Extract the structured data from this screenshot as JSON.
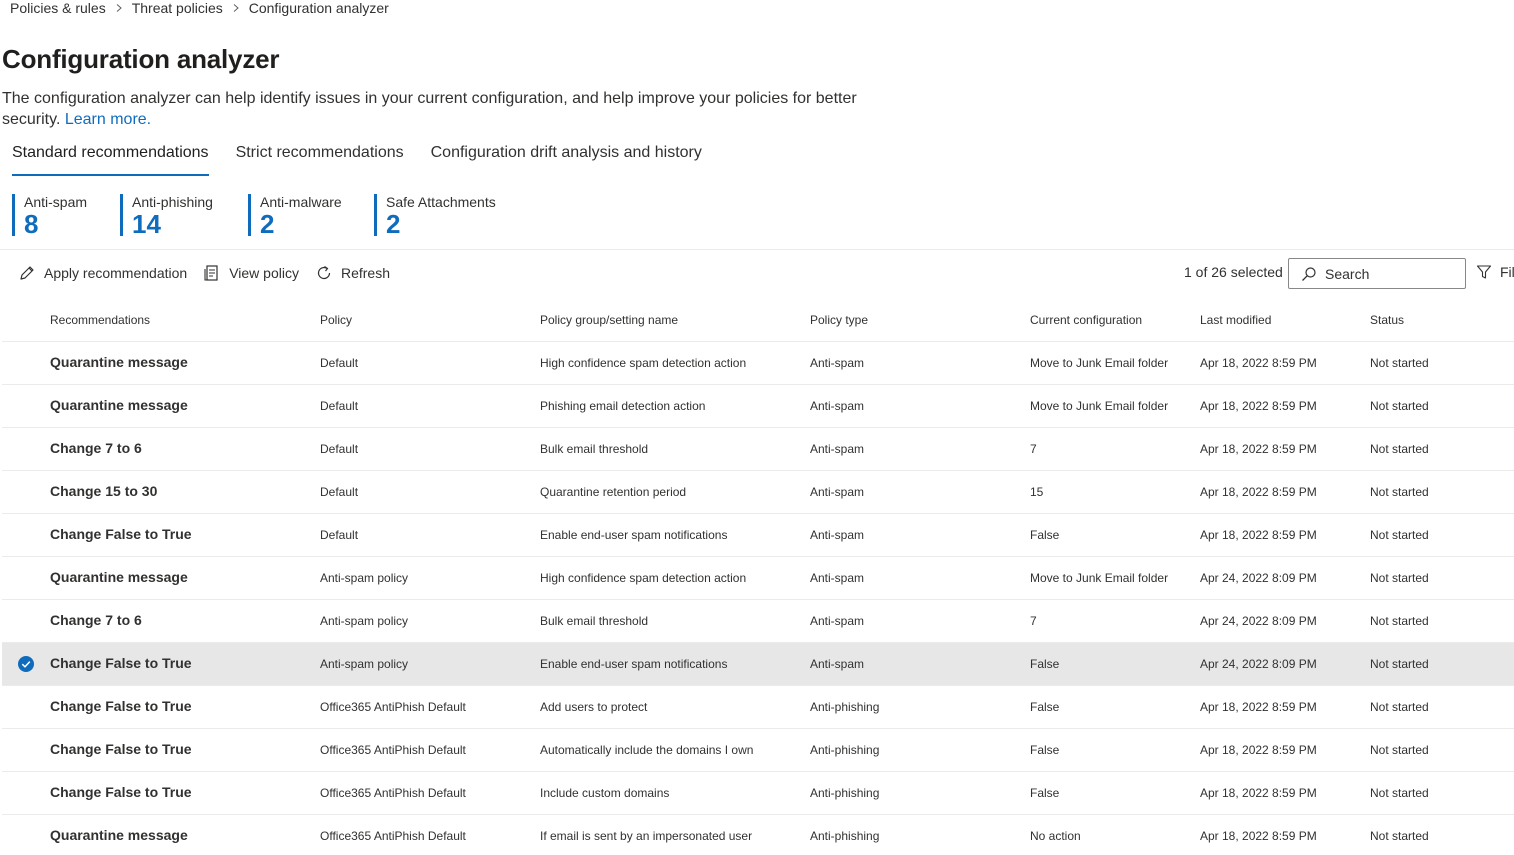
{
  "breadcrumb": [
    "Policies & rules",
    "Threat policies",
    "Configuration analyzer"
  ],
  "page": {
    "title": "Configuration analyzer",
    "description": "The configuration analyzer can help identify issues in your current configuration, and help improve your policies for better security.",
    "learn_more": "Learn more."
  },
  "tabs": [
    {
      "label": "Standard recommendations",
      "active": true
    },
    {
      "label": "Strict recommendations",
      "active": false
    },
    {
      "label": "Configuration drift analysis and history",
      "active": false
    }
  ],
  "counters": [
    {
      "label": "Anti-spam",
      "value": "8"
    },
    {
      "label": "Anti-phishing",
      "value": "14"
    },
    {
      "label": "Anti-malware",
      "value": "2"
    },
    {
      "label": "Safe Attachments",
      "value": "2"
    }
  ],
  "toolbar": {
    "apply": "Apply recommendation",
    "view": "View policy",
    "refresh": "Refresh",
    "selected": "1 of 26 selected",
    "search_placeholder": "Search",
    "filter": "Fil"
  },
  "accent_color": "#0f6cbd",
  "table": {
    "columns": [
      "Recommendations",
      "Policy",
      "Policy group/setting name",
      "Policy type",
      "Current configuration",
      "Last modified",
      "Status"
    ],
    "rows": [
      {
        "rec": "Quarantine message",
        "policy": "Default",
        "setting": "High confidence spam detection action",
        "type": "Anti-spam",
        "config": "Move to Junk Email folder",
        "modified": "Apr 18, 2022 8:59 PM",
        "status": "Not started",
        "selected": false
      },
      {
        "rec": "Quarantine message",
        "policy": "Default",
        "setting": "Phishing email detection action",
        "type": "Anti-spam",
        "config": "Move to Junk Email folder",
        "modified": "Apr 18, 2022 8:59 PM",
        "status": "Not started",
        "selected": false
      },
      {
        "rec": "Change 7 to 6",
        "policy": "Default",
        "setting": "Bulk email threshold",
        "type": "Anti-spam",
        "config": "7",
        "modified": "Apr 18, 2022 8:59 PM",
        "status": "Not started",
        "selected": false
      },
      {
        "rec": "Change 15 to 30",
        "policy": "Default",
        "setting": "Quarantine retention period",
        "type": "Anti-spam",
        "config": "15",
        "modified": "Apr 18, 2022 8:59 PM",
        "status": "Not started",
        "selected": false
      },
      {
        "rec": "Change False to True",
        "policy": "Default",
        "setting": "Enable end-user spam notifications",
        "type": "Anti-spam",
        "config": "False",
        "modified": "Apr 18, 2022 8:59 PM",
        "status": "Not started",
        "selected": false
      },
      {
        "rec": "Quarantine message",
        "policy": "Anti-spam policy",
        "setting": "High confidence spam detection action",
        "type": "Anti-spam",
        "config": "Move to Junk Email folder",
        "modified": "Apr 24, 2022 8:09 PM",
        "status": "Not started",
        "selected": false
      },
      {
        "rec": "Change 7 to 6",
        "policy": "Anti-spam policy",
        "setting": "Bulk email threshold",
        "type": "Anti-spam",
        "config": "7",
        "modified": "Apr 24, 2022 8:09 PM",
        "status": "Not started",
        "selected": false
      },
      {
        "rec": "Change False to True",
        "policy": "Anti-spam policy",
        "setting": "Enable end-user spam notifications",
        "type": "Anti-spam",
        "config": "False",
        "modified": "Apr 24, 2022 8:09 PM",
        "status": "Not started",
        "selected": true
      },
      {
        "rec": "Change False to True",
        "policy": "Office365 AntiPhish Default",
        "setting": "Add users to protect",
        "type": "Anti-phishing",
        "config": "False",
        "modified": "Apr 18, 2022 8:59 PM",
        "status": "Not started",
        "selected": false
      },
      {
        "rec": "Change False to True",
        "policy": "Office365 AntiPhish Default",
        "setting": "Automatically include the domains I own",
        "type": "Anti-phishing",
        "config": "False",
        "modified": "Apr 18, 2022 8:59 PM",
        "status": "Not started",
        "selected": false
      },
      {
        "rec": "Change False to True",
        "policy": "Office365 AntiPhish Default",
        "setting": "Include custom domains",
        "type": "Anti-phishing",
        "config": "False",
        "modified": "Apr 18, 2022 8:59 PM",
        "status": "Not started",
        "selected": false
      },
      {
        "rec": "Quarantine message",
        "policy": "Office365 AntiPhish Default",
        "setting": "If email is sent by an impersonated user",
        "type": "Anti-phishing",
        "config": "No action",
        "modified": "Apr 18, 2022 8:59 PM",
        "status": "Not started",
        "selected": false
      }
    ]
  }
}
